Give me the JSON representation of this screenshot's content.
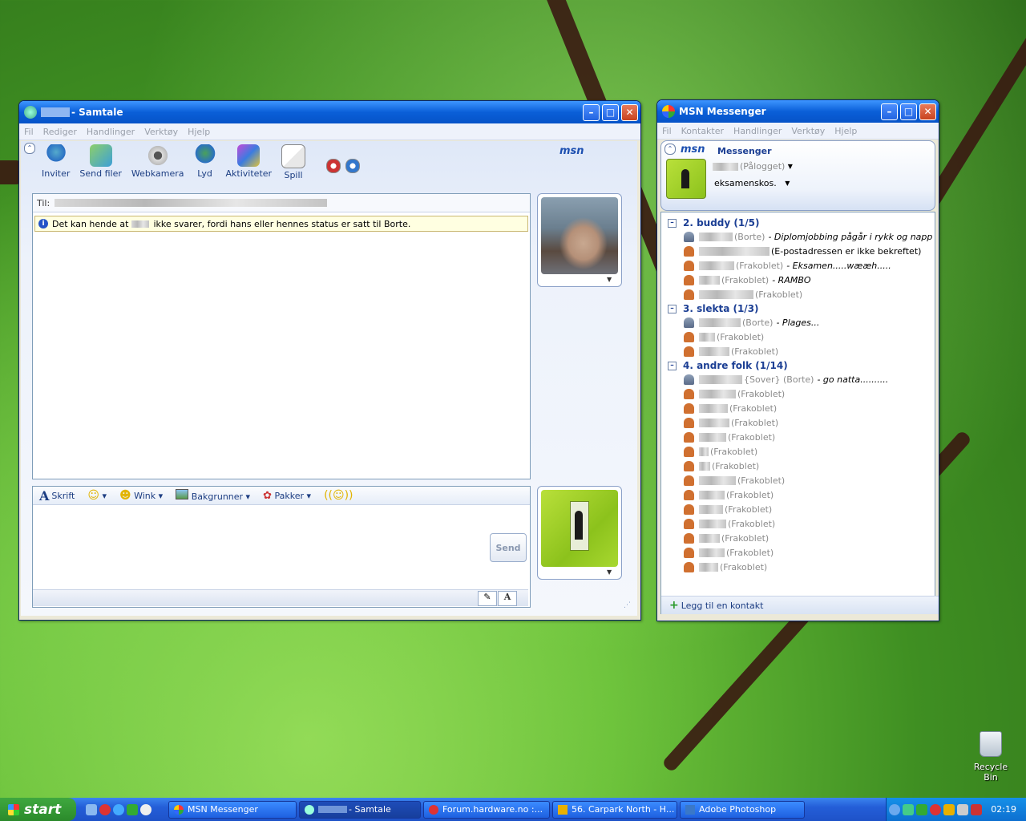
{
  "chat_window": {
    "title": "- Samtale",
    "menu": [
      "Fil",
      "Rediger",
      "Handlinger",
      "Verktøy",
      "Hjelp"
    ],
    "toolbar": [
      "Inviter",
      "Send filer",
      "Webkamera",
      "Lyd",
      "Aktiviteter",
      "Spill"
    ],
    "msn_logo": "msn",
    "to_label": "Til:",
    "notice_pre": "Det kan hende at",
    "notice_post": "ikke svarer, fordi hans eller hennes status er satt til Borte.",
    "format_bar": [
      "Skrift",
      "Wink",
      "Bakgrunner",
      "Pakker"
    ],
    "send_label": "Send"
  },
  "messenger_window": {
    "title": "MSN Messenger",
    "menu": [
      "Fil",
      "Kontakter",
      "Handlinger",
      "Verktøy",
      "Hjelp"
    ],
    "messenger_label": "Messenger",
    "my_status": "(Pålogget)",
    "my_message": "eksamenskos.",
    "groups": [
      {
        "name": "2. buddy (1/5)",
        "contacts": [
          {
            "status": "(Borte)",
            "msg": "- Diplomjobbing pågår i rykk og napp"
          },
          {
            "status": "(E-postadressen er ikke bekreftet)",
            "msg": ""
          },
          {
            "status": "(Frakoblet)",
            "msg": "- Eksamen.....wææh....."
          },
          {
            "status": "(Frakoblet)",
            "msg": "- RAMBO"
          },
          {
            "status": "(Frakoblet)",
            "msg": ""
          }
        ]
      },
      {
        "name": "3. slekta (1/3)",
        "contacts": [
          {
            "status": "(Borte)",
            "msg": "- Plages..."
          },
          {
            "status": "(Frakoblet)",
            "msg": ""
          },
          {
            "status": "(Frakoblet)",
            "msg": ""
          }
        ]
      },
      {
        "name": "4. andre folk (1/14)",
        "contacts": [
          {
            "status": "{Sover} (Borte)",
            "msg": "- go natta.........."
          },
          {
            "status": "(Frakoblet)",
            "msg": ""
          },
          {
            "status": "(Frakoblet)",
            "msg": ""
          },
          {
            "status": "(Frakoblet)",
            "msg": ""
          },
          {
            "status": "(Frakoblet)",
            "msg": ""
          },
          {
            "status": "(Frakoblet)",
            "msg": ""
          },
          {
            "status": "(Frakoblet)",
            "msg": ""
          },
          {
            "status": "(Frakoblet)",
            "msg": ""
          },
          {
            "status": "(Frakoblet)",
            "msg": ""
          },
          {
            "status": "(Frakoblet)",
            "msg": ""
          },
          {
            "status": "(Frakoblet)",
            "msg": ""
          },
          {
            "status": "(Frakoblet)",
            "msg": ""
          },
          {
            "status": "(Frakoblet)",
            "msg": ""
          },
          {
            "status": "(Frakoblet)",
            "msg": ""
          }
        ]
      }
    ],
    "add_contact": "Legg til en kontakt"
  },
  "desktop": {
    "recycle_bin": "Recycle Bin"
  },
  "taskbar": {
    "start": "start",
    "tasks": [
      "MSN Messenger",
      "- Samtale",
      "Forum.hardware.no :...",
      "56. Carpark North - H...",
      "Adobe Photoshop"
    ],
    "clock": "02:19"
  }
}
